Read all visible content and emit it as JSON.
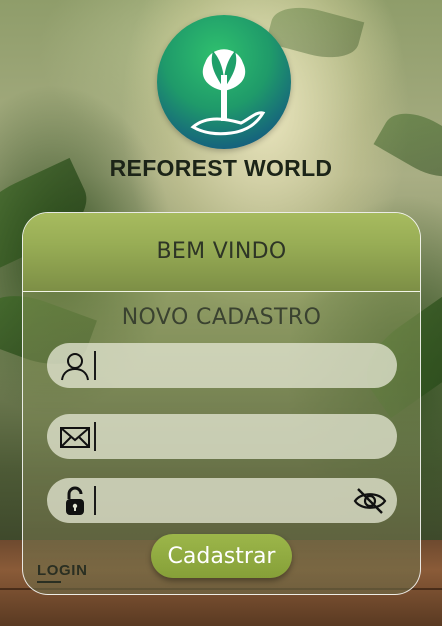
{
  "brand": {
    "name": "REFOREST WORLD",
    "logo_icon": "sprout-hand-icon"
  },
  "card": {
    "welcome": "BEM VINDO",
    "title": "NOVO CADASTRO"
  },
  "fields": [
    {
      "name": "user",
      "icon": "user-icon",
      "value": "",
      "placeholder": ""
    },
    {
      "name": "email",
      "icon": "envelope-icon",
      "value": "",
      "placeholder": ""
    },
    {
      "name": "password",
      "icon": "unlocked-padlock-icon",
      "value": "",
      "placeholder": "",
      "toggle_icon": "eye-slash-icon"
    }
  ],
  "actions": {
    "login_label": "LOGIN",
    "submit_label": "Cadastrar"
  },
  "colors": {
    "accent": "#8fab3f",
    "logo_green": "#2fc06e",
    "logo_blue": "#124c79",
    "text_dark": "#1c2418"
  }
}
